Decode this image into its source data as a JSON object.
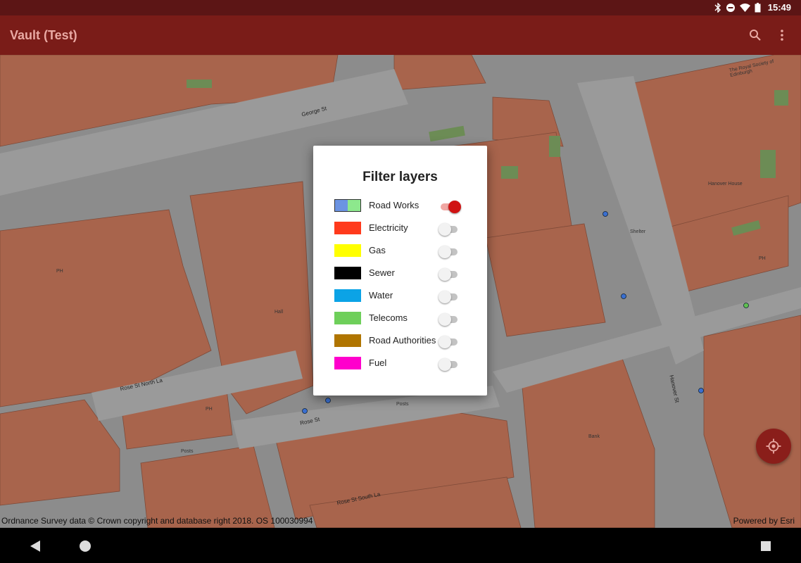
{
  "status_bar": {
    "time": "15:49",
    "icons": [
      "bluetooth-icon",
      "do-not-disturb-icon",
      "wifi-icon",
      "battery-icon"
    ]
  },
  "app_bar": {
    "title": "Vault (Test)",
    "actions": [
      "search-icon",
      "more-vert-icon"
    ]
  },
  "map": {
    "street_labels": [
      "George St",
      "Rose St North La",
      "Rose St",
      "Rose St South La",
      "Hanover St"
    ],
    "building_labels": [
      "The Royal Society of Edinburgh",
      "Hanover House",
      "Shelter",
      "Hall",
      "PH",
      "PH",
      "PH",
      "Bank",
      "Posts",
      "Posts"
    ],
    "attribution": "Ordnance Survey data © Crown copyright and database right 2018. OS 100030994",
    "powered_by": "Powered by Esri"
  },
  "dialog": {
    "title": "Filter layers",
    "layers": [
      {
        "label": "Road Works",
        "colors": [
          "#6b93e2",
          "#8de88d"
        ],
        "enabled": true
      },
      {
        "label": "Electricity",
        "colors": [
          "#ff3a1c"
        ],
        "enabled": false
      },
      {
        "label": "Gas",
        "colors": [
          "#ffff00"
        ],
        "enabled": false
      },
      {
        "label": "Sewer",
        "colors": [
          "#000000"
        ],
        "enabled": false
      },
      {
        "label": "Water",
        "colors": [
          "#0ba3e6"
        ],
        "enabled": false
      },
      {
        "label": "Telecoms",
        "colors": [
          "#6ecf5a"
        ],
        "enabled": false
      },
      {
        "label": "Road Authorities",
        "colors": [
          "#b07500"
        ],
        "enabled": false
      },
      {
        "label": "Fuel",
        "colors": [
          "#ff00cc"
        ],
        "enabled": false
      }
    ]
  },
  "fab": {
    "icon": "my-location-icon"
  },
  "nav_bar": {
    "buttons": [
      "back-icon",
      "home-icon",
      "recents-icon"
    ]
  },
  "colors": {
    "app_bar": "#7a1c18",
    "status_bar": "#5c1515",
    "accent": "#d01212",
    "building": "#a8644c",
    "road": "#8a8a8a"
  }
}
